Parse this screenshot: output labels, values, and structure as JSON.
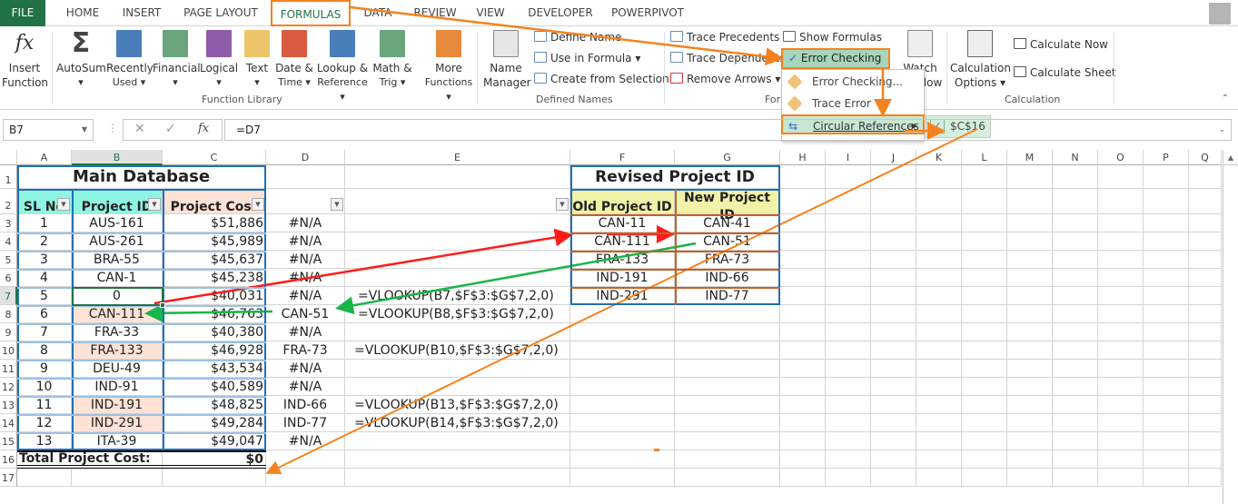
{
  "tabs": [
    "FILE",
    "HOME",
    "INSERT",
    "PAGE LAYOUT",
    "FORMULAS",
    "DATA",
    "REVIEW",
    "VIEW",
    "DEVELOPER",
    "POWERPIVOT"
  ],
  "active_tab": "FORMULAS",
  "ribbon": {
    "insert_function": [
      "Insert",
      "Function"
    ],
    "function_library": {
      "label": "Function Library",
      "buttons": [
        {
          "l1": "AutoSum",
          "l2": "▾",
          "icon": "sigma-icon",
          "color": "#444444"
        },
        {
          "l1": "Recently",
          "l2": "Used ▾",
          "icon": "star-book-icon",
          "color": "#4a7ebb"
        },
        {
          "l1": "Financial",
          "l2": "▾",
          "icon": "coins-book-icon",
          "color": "#6aa57e"
        },
        {
          "l1": "Logical",
          "l2": "▾",
          "icon": "question-book-icon",
          "color": "#8e5ba8"
        },
        {
          "l1": "Text",
          "l2": "▾",
          "icon": "text-book-icon",
          "color": "#eec46a"
        },
        {
          "l1": "Date &",
          "l2": "Time ▾",
          "icon": "calendar-book-icon",
          "color": "#d85c41"
        },
        {
          "l1": "Lookup &",
          "l2": "Reference ▾",
          "icon": "magnifier-book-icon",
          "color": "#4a7ebb"
        },
        {
          "l1": "Math &",
          "l2": "Trig ▾",
          "icon": "theta-book-icon",
          "color": "#6aa57e"
        },
        {
          "l1": "More",
          "l2": "Functions ▾",
          "icon": "ellipsis-book-icon",
          "color": "#e88a3c"
        }
      ]
    },
    "defined_names": {
      "label": "Defined Names",
      "name_manager": [
        "Name",
        "Manager"
      ],
      "define_name": "Define Name",
      "use_in_formula": "Use in Formula ▾",
      "create_from_selection": "Create from Selection"
    },
    "formula_auditing": {
      "label": "Formu",
      "trace_precedents": "Trace Precedents",
      "trace_dependents": "Trace Dependents",
      "remove_arrows": "Remove Arrows ▾",
      "show_formulas": "Show Formulas",
      "error_checking": "Error Checking",
      "watch_window": [
        "Watch",
        "Window"
      ]
    },
    "calculation": {
      "label": "Calculation",
      "options": [
        "Calculation",
        "Options ▾"
      ],
      "calc_now": "Calculate Now",
      "calc_sheet": "Calculate Sheet"
    }
  },
  "error_menu": {
    "items": [
      "Error Checking...",
      "Trace Error",
      "Circular References"
    ],
    "submenu_item": "$C$16"
  },
  "formula_bar": {
    "name_box": "B7",
    "formula": "=D7",
    "fx": "fx"
  },
  "columns": [
    "A",
    "B",
    "C",
    "D",
    "E",
    "F",
    "G",
    "H",
    "I",
    "J",
    "K",
    "L",
    "M",
    "N",
    "O",
    "P",
    "Q"
  ],
  "rows": [
    "1",
    "2",
    "3",
    "4",
    "5",
    "6",
    "7",
    "8",
    "9",
    "10",
    "11",
    "12",
    "13",
    "14",
    "15",
    "16",
    "17"
  ],
  "main_table": {
    "title": "Main Database",
    "headers": [
      "SL No",
      "Project ID",
      "Project Cost"
    ],
    "rows": [
      [
        "1",
        "AUS-161",
        "$51,886",
        "#N/A",
        ""
      ],
      [
        "2",
        "AUS-261",
        "$45,989",
        "#N/A",
        ""
      ],
      [
        "3",
        "BRA-55",
        "$45,637",
        "#N/A",
        ""
      ],
      [
        "4",
        "CAN-1",
        "$45,238",
        "#N/A",
        ""
      ],
      [
        "5",
        "0",
        "$40,031",
        "#N/A",
        "=VLOOKUP(B7,$F$3:$G$7,2,0)"
      ],
      [
        "6",
        "CAN-111",
        "$46,763",
        "CAN-51",
        "=VLOOKUP(B8,$F$3:$G$7,2,0)"
      ],
      [
        "7",
        "FRA-33",
        "$40,380",
        "#N/A",
        ""
      ],
      [
        "8",
        "FRA-133",
        "$46,928",
        "FRA-73",
        "=VLOOKUP(B10,$F$3:$G$7,2,0)"
      ],
      [
        "9",
        "DEU-49",
        "$43,534",
        "#N/A",
        ""
      ],
      [
        "10",
        "IND-91",
        "$40,589",
        "#N/A",
        ""
      ],
      [
        "11",
        "IND-191",
        "$48,825",
        "IND-66",
        "=VLOOKUP(B13,$F$3:$G$7,2,0)"
      ],
      [
        "12",
        "IND-291",
        "$49,284",
        "IND-77",
        "=VLOOKUP(B14,$F$3:$G$7,2,0)"
      ],
      [
        "13",
        "ITA-39",
        "$49,047",
        "#N/A",
        ""
      ]
    ],
    "highlighted_ids": [
      6,
      8,
      11,
      12
    ],
    "total_label": "Total Project Cost:",
    "total_value": "$0"
  },
  "revised_table": {
    "title": "Revised Project ID",
    "headers": [
      "Old Project ID",
      "New Project ID"
    ],
    "rows": [
      [
        "CAN-11",
        "CAN-41"
      ],
      [
        "CAN-111",
        "CAN-51"
      ],
      [
        "FRA-133",
        "FRA-73"
      ],
      [
        "IND-191",
        "IND-66"
      ],
      [
        "IND-291",
        "IND-77"
      ]
    ]
  },
  "colors": {
    "accent": "#217346",
    "annotation": "#f58220",
    "table_border": "#1f6fb8",
    "header_teal": "#8ff5e3",
    "header_peach": "#fde2d6",
    "header_yellow": "#f1f2a7",
    "precedent_arrow": "#ff1a1a",
    "dependent_arrow": "#1ab54a"
  }
}
